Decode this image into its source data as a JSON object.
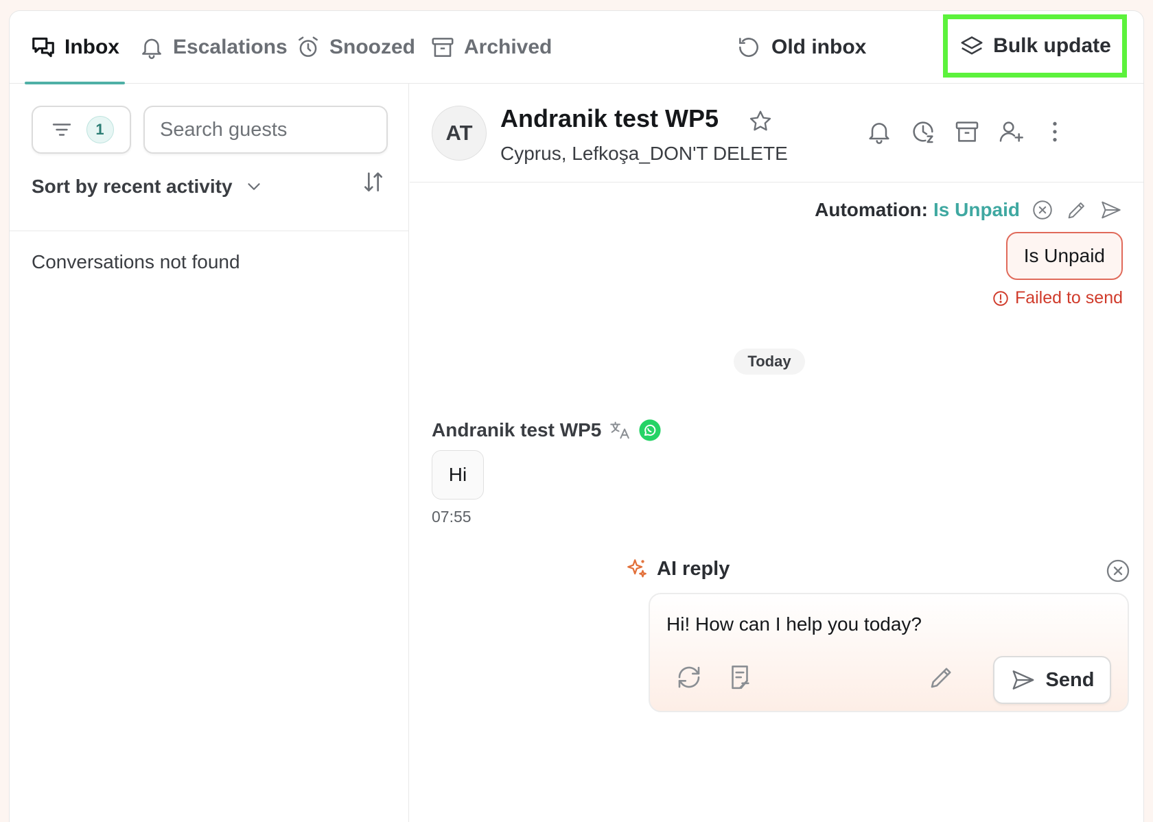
{
  "tabs": [
    {
      "label": "Inbox",
      "icon": "chat-bubbles-icon",
      "active": true
    },
    {
      "label": "Escalations",
      "icon": "bell-icon",
      "active": false
    },
    {
      "label": "Snoozed",
      "icon": "alarm-clock-icon",
      "active": false
    },
    {
      "label": "Archived",
      "icon": "archive-box-icon",
      "active": false
    }
  ],
  "header_actions": {
    "old_inbox": "Old inbox",
    "bulk_update": "Bulk update"
  },
  "sidebar": {
    "filter_count": "1",
    "search_placeholder": "Search guests",
    "sort_label": "Sort by recent activity",
    "empty_text": "Conversations not found"
  },
  "conversation": {
    "avatar_initials": "AT",
    "name": "Andranik test WP5",
    "subtitle": "Cyprus, Lefkoşa_DON'T DELETE",
    "header_icons": [
      "bell-icon",
      "snooze-clock-icon",
      "archive-icon",
      "add-user-icon",
      "more-vertical-icon"
    ]
  },
  "automation": {
    "label": "Automation:",
    "value": "Is Unpaid"
  },
  "outgoing_message": {
    "text": "Is Unpaid",
    "status": "Failed to send"
  },
  "date_divider": "Today",
  "incoming_message": {
    "author": "Andranik test WP5",
    "text": "Hi",
    "time": "07:55"
  },
  "ai_reply": {
    "title": "AI reply",
    "text": "Hi! How can I help you today?",
    "send_label": "Send"
  },
  "colors": {
    "accent_teal": "#4fb0a6",
    "highlight_green": "#5cf23c",
    "error_red": "#d03b2b",
    "ai_orange": "#e2703a",
    "whatsapp_green": "#25d366"
  }
}
